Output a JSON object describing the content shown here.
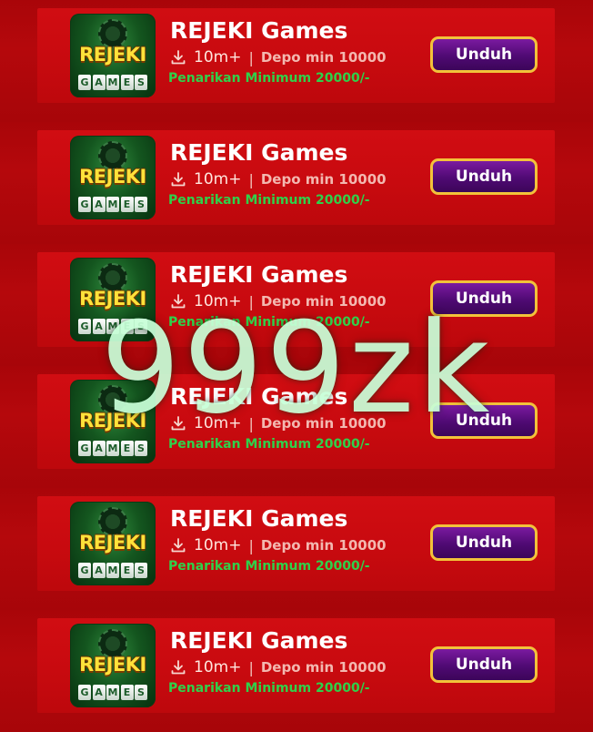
{
  "apps": [
    {
      "title": "REJEKI Games",
      "downloads": "10m+",
      "separator": "|",
      "deposit": "Depo min 10000",
      "withdraw": "Penarikan Minimum 20000/-",
      "button": "Unduh",
      "icon_word": "REJEKI",
      "icon_sub": [
        "G",
        "A",
        "M",
        "E",
        "S"
      ]
    },
    {
      "title": "REJEKI Games",
      "downloads": "10m+",
      "separator": "|",
      "deposit": "Depo min 10000",
      "withdraw": "Penarikan Minimum 20000/-",
      "button": "Unduh",
      "icon_word": "REJEKI",
      "icon_sub": [
        "G",
        "A",
        "M",
        "E",
        "S"
      ]
    },
    {
      "title": "REJEKI Games",
      "downloads": "10m+",
      "separator": "|",
      "deposit": "Depo min 10000",
      "withdraw": "Penarikan Minimum 20000/-",
      "button": "Unduh",
      "icon_word": "REJEKI",
      "icon_sub": [
        "G",
        "A",
        "M",
        "E",
        "S"
      ]
    },
    {
      "title": "REJEKI Games",
      "downloads": "10m+",
      "separator": "|",
      "deposit": "Depo min 10000",
      "withdraw": "Penarikan Minimum 20000/-",
      "button": "Unduh",
      "icon_word": "REJEKI",
      "icon_sub": [
        "G",
        "A",
        "M",
        "E",
        "S"
      ]
    },
    {
      "title": "REJEKI Games",
      "downloads": "10m+",
      "separator": "|",
      "deposit": "Depo min 10000",
      "withdraw": "Penarikan Minimum 20000/-",
      "button": "Unduh",
      "icon_word": "REJEKI",
      "icon_sub": [
        "G",
        "A",
        "M",
        "E",
        "S"
      ]
    },
    {
      "title": "REJEKI Games",
      "downloads": "10m+",
      "separator": "|",
      "deposit": "Depo min 10000",
      "withdraw": "Penarikan Minimum 20000/-",
      "button": "Unduh",
      "icon_word": "REJEKI",
      "icon_sub": [
        "G",
        "A",
        "M",
        "E",
        "S"
      ]
    }
  ],
  "watermark": "999zk",
  "icons": {
    "download": "download-icon",
    "app_logo": "rejeki-games-logo-icon"
  },
  "colors": {
    "background": "#b5070b",
    "card": "#c80a0f",
    "title_text": "#ffffff",
    "withdraw_text": "#2fd14a",
    "button_fill": "#5a0c82",
    "button_border": "#f2c23a",
    "watermark": "#c8ffd8"
  }
}
